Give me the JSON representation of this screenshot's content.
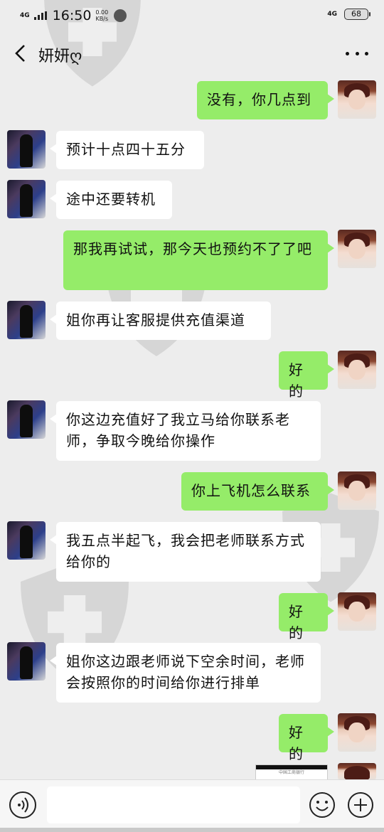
{
  "status_bar": {
    "network_left": "4G",
    "time": "16:50",
    "speed_value": "0.00",
    "speed_unit": "KB/s",
    "network_right": "4G",
    "battery": "68"
  },
  "header": {
    "title": "妍妍ღ",
    "back_icon": "chevron-left-icon",
    "more_icon": "more-dots-icon"
  },
  "messages": [
    {
      "side": "out",
      "text": "没有，你几点到"
    },
    {
      "side": "in",
      "text": "预计十点四十五分"
    },
    {
      "side": "in",
      "text": "途中还要转机"
    },
    {
      "side": "out",
      "text": "那我再试试，那今天也预约不了了吧"
    },
    {
      "side": "in",
      "text": "姐你再让客服提供充值渠道"
    },
    {
      "side": "out",
      "text": "好的"
    },
    {
      "side": "in",
      "text": "你这边充值好了我立马给你联系老师，争取今晚给你操作"
    },
    {
      "side": "out",
      "text": "你上飞机怎么联系"
    },
    {
      "side": "in",
      "text": "我五点半起飞，我会把老师联系方式给你的"
    },
    {
      "side": "out",
      "text": "好的"
    },
    {
      "side": "in",
      "text": "姐你这边跟老师说下空余时间，老师会按照你的时间给你进行排单"
    },
    {
      "side": "out",
      "text": "好的"
    }
  ],
  "image_message": {
    "caption": "中国工商银行"
  },
  "input_bar": {
    "voice_icon": "voice-icon",
    "value": "",
    "emoji_icon": "emoji-icon",
    "plus_icon": "plus-icon"
  },
  "colors": {
    "background": "#ededed",
    "outgoing_bubble": "#95ec69",
    "incoming_bubble": "#ffffff"
  }
}
